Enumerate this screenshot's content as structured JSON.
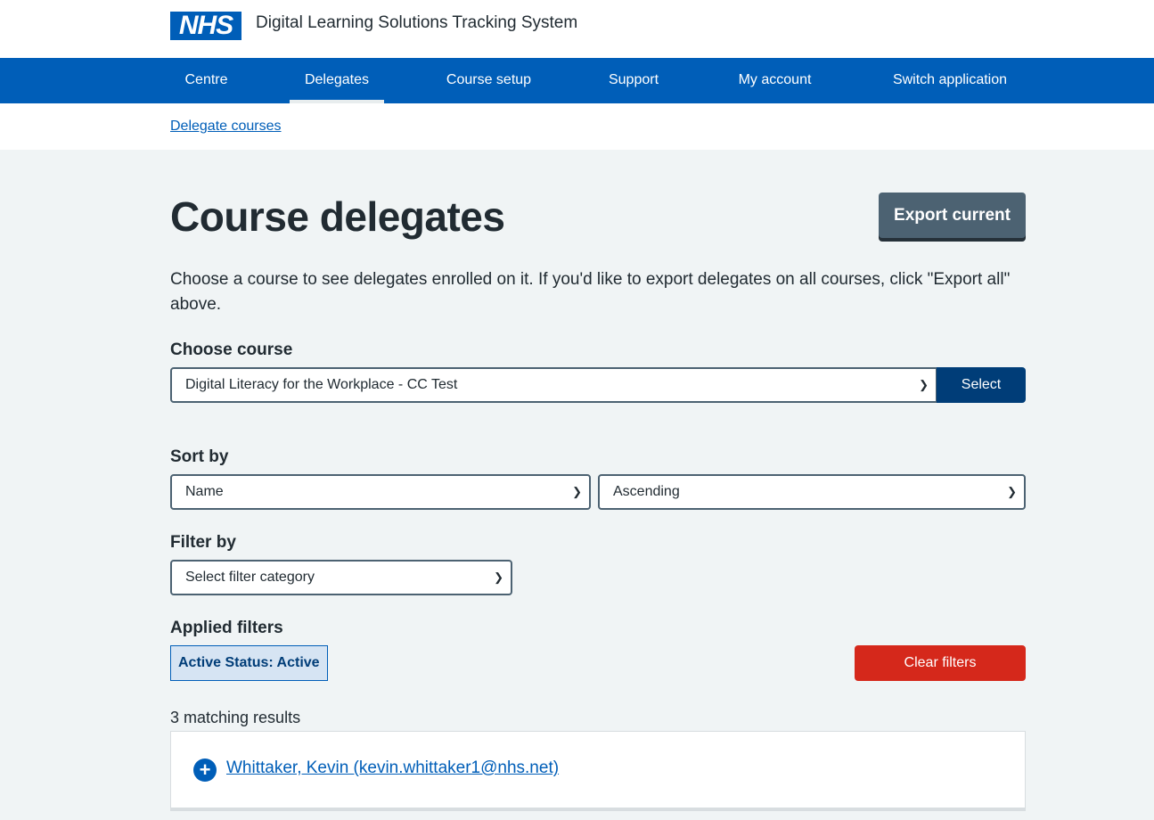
{
  "header": {
    "logo_text": "NHS",
    "app_title": "Digital Learning Solutions Tracking System"
  },
  "nav": {
    "items": [
      {
        "label": "Centre"
      },
      {
        "label": "Delegates",
        "active": true
      },
      {
        "label": "Course setup"
      },
      {
        "label": "Support"
      },
      {
        "label": "My account"
      },
      {
        "label": "Switch application"
      }
    ]
  },
  "breadcrumb": {
    "label": "Delegate courses"
  },
  "page": {
    "title": "Course delegates",
    "export_button": "Export current",
    "intro": "Choose a course to see delegates enrolled on it. If you'd like to export delegates on all courses, click \"Export all\" above."
  },
  "course": {
    "label": "Choose course",
    "selected": "Digital Literacy for the Workplace - CC Test",
    "select_button": "Select"
  },
  "sort": {
    "label": "Sort by",
    "field": "Name",
    "direction": "Ascending"
  },
  "filter": {
    "label": "Filter by",
    "category": "Select filter category",
    "applied_label": "Applied filters",
    "applied": [
      "Active Status: Active"
    ],
    "clear_button": "Clear filters"
  },
  "results": {
    "count_text": "3 matching results",
    "items": [
      {
        "label": "Whittaker, Kevin (kevin.whittaker1@nhs.net)"
      }
    ]
  },
  "colors": {
    "nhs_blue": "#005eb8",
    "dark_blue": "#003d78",
    "background": "#f0f4f5",
    "export_grey": "#4c6272",
    "clear_red": "#d5281b"
  }
}
